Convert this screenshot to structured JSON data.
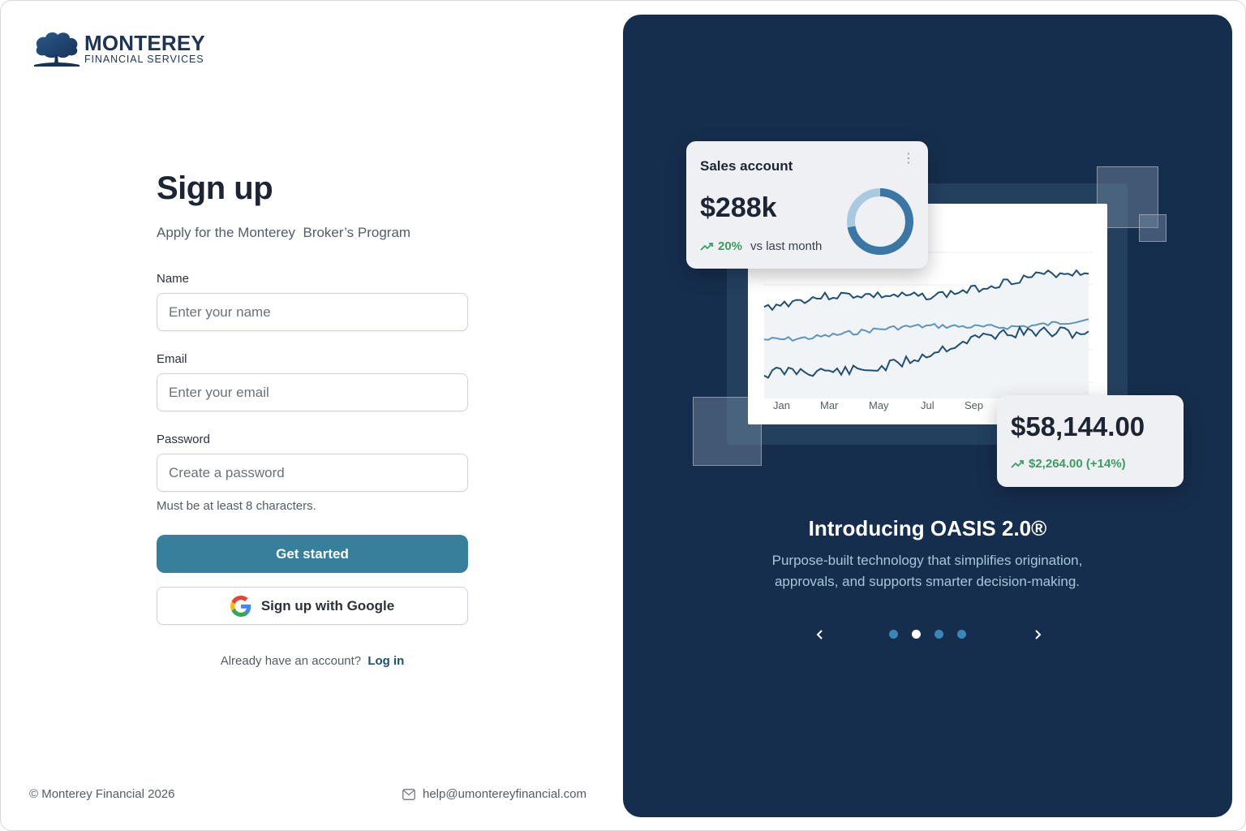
{
  "brand": {
    "name": "MONTEREY",
    "tagline": "FINANCIAL SERVICES"
  },
  "form": {
    "title": "Sign up",
    "subtitle": "Apply for the Monterey  Broker’s Program",
    "name_label": "Name",
    "name_placeholder": "Enter your name",
    "email_label": "Email",
    "email_placeholder": "Enter your email",
    "password_label": "Password",
    "password_placeholder": "Create a password",
    "password_hint": "Must be at least 8 characters.",
    "submit_label": "Get started",
    "google_label": "Sign up with Google",
    "login_prompt": "Already have an account?",
    "login_link": "Log in"
  },
  "footer": {
    "copyright": "© Monterey Financial 2026",
    "email": "help@umontereyfinancial.com"
  },
  "promo": {
    "sales_card": {
      "title": "Sales account",
      "value": "$288k",
      "change": "20%",
      "change_suffix": "vs last month",
      "donut_fraction": 0.72
    },
    "balance_card": {
      "value": "$58,144.00",
      "change": "$2,264.00 (+14%)"
    },
    "months": [
      "Jan",
      "Mar",
      "May",
      "Jul",
      "Sep"
    ],
    "headline": "Introducing OASIS 2.0®",
    "description": "Purpose-built technology that simplifies origination, approvals, and supports smarter decision-making.",
    "carousel": {
      "total": 4,
      "active_index": 1
    }
  },
  "colors": {
    "primary": "#377f9b",
    "panel": "#162e4d",
    "positive": "#3a9e5c",
    "line_dark": "#1f4f74",
    "line_light": "#5b95b8"
  }
}
